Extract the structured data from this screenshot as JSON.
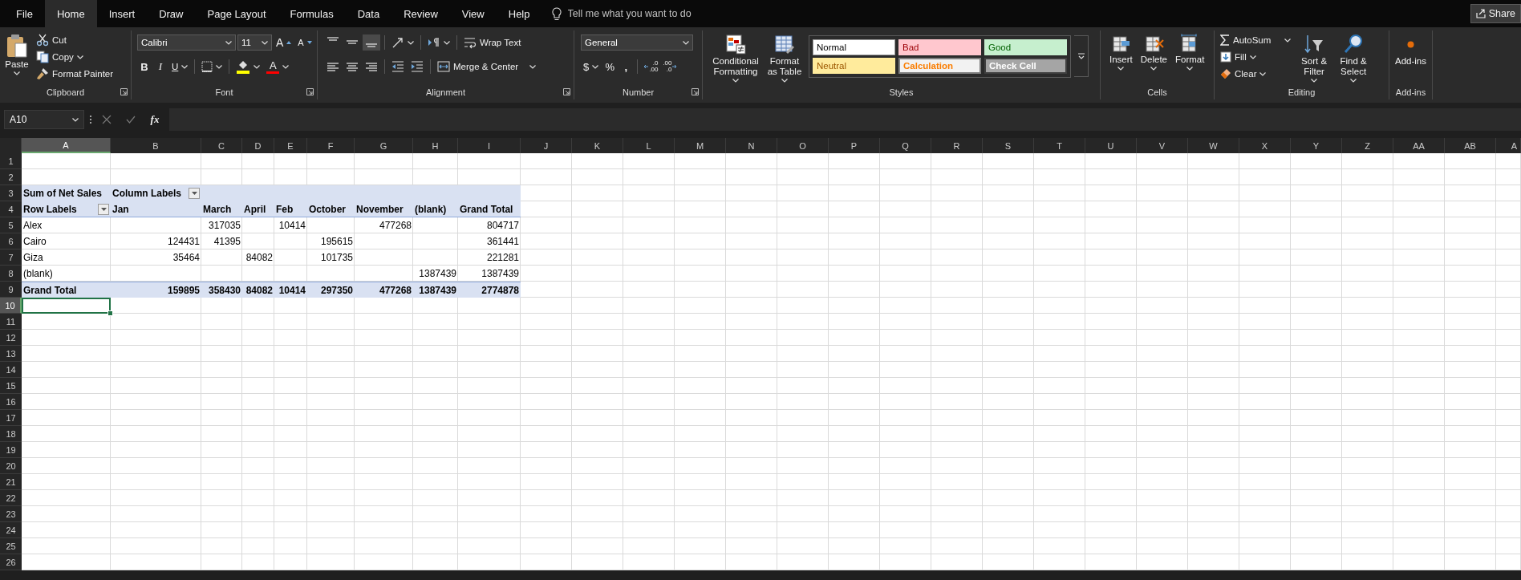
{
  "menu": {
    "tabs": [
      {
        "label": "File",
        "selected": false
      },
      {
        "label": "Home",
        "selected": true
      },
      {
        "label": "Insert",
        "selected": false
      },
      {
        "label": "Draw",
        "selected": false
      },
      {
        "label": "Page Layout",
        "selected": false
      },
      {
        "label": "Formulas",
        "selected": false
      },
      {
        "label": "Data",
        "selected": false
      },
      {
        "label": "Review",
        "selected": false
      },
      {
        "label": "View",
        "selected": false
      },
      {
        "label": "Help",
        "selected": false
      }
    ],
    "tell_me": {
      "placeholder": "Tell me what you want to do"
    },
    "share": "Share"
  },
  "ribbon": {
    "clipboard": {
      "label": "Clipboard",
      "paste": "Paste",
      "cut": "Cut",
      "copy": "Copy",
      "format_painter": "Format Painter"
    },
    "font": {
      "label": "Font",
      "font_name": "Calibri",
      "font_size": "11",
      "grow": "A",
      "shrink": "A",
      "bold": "B",
      "italic": "I",
      "underline": "U",
      "font_color": "A"
    },
    "alignment": {
      "label": "Alignment",
      "vertical": [
        {
          "kind": "top",
          "selected": false
        },
        {
          "kind": "middle",
          "selected": false
        },
        {
          "kind": "bottom",
          "selected": true
        }
      ],
      "wrap_text": "Wrap Text",
      "merge": "Merge & Center"
    },
    "number": {
      "label": "Number",
      "format": "General",
      "currency": "$",
      "percent": "%",
      "comma": ",",
      "increase_decimal": {
        "top": ".0",
        "bottom": ".00"
      },
      "decrease_decimal": {
        "top": ".00",
        "bottom": ".0"
      }
    },
    "styles": {
      "label": "Styles",
      "conditional": "Conditional Formatting",
      "format_table": "Format as Table",
      "cell_styles": [
        {
          "label": "Normal",
          "kind": "normal"
        },
        {
          "label": "Bad",
          "kind": "bad"
        },
        {
          "label": "Good",
          "kind": "good"
        },
        {
          "label": "Neutral",
          "kind": "neutral"
        },
        {
          "label": "Calculation",
          "kind": "calculation"
        },
        {
          "label": "Check Cell",
          "kind": "check"
        }
      ]
    },
    "cells": {
      "label": "Cells",
      "buttons": [
        {
          "label": "Insert",
          "kind": "insert"
        },
        {
          "label": "Delete",
          "kind": "delete"
        },
        {
          "label": "Format",
          "kind": "format"
        }
      ]
    },
    "editing": {
      "label": "Editing",
      "autosum": "AutoSum",
      "fill": "Fill",
      "clear": "Clear",
      "sort": "Sort & Filter",
      "find": "Find & Select"
    },
    "addins": {
      "label": "Add-ins",
      "button": "Add-ins"
    }
  },
  "formula_bar": {
    "name_box": "A10",
    "fx": "fx"
  },
  "sheet": {
    "columns": [
      {
        "label": "A",
        "selected": true
      },
      {
        "label": "B",
        "selected": false
      },
      {
        "label": "C",
        "selected": false
      },
      {
        "label": "D",
        "selected": false
      },
      {
        "label": "E",
        "selected": false
      },
      {
        "label": "F",
        "selected": false
      },
      {
        "label": "G",
        "selected": false
      },
      {
        "label": "H",
        "selected": false
      },
      {
        "label": "I",
        "selected": false
      },
      {
        "label": "J",
        "selected": false
      },
      {
        "label": "K",
        "selected": false
      },
      {
        "label": "L",
        "selected": false
      },
      {
        "label": "M",
        "selected": false
      },
      {
        "label": "N",
        "selected": false
      },
      {
        "label": "O",
        "selected": false
      },
      {
        "label": "P",
        "selected": false
      },
      {
        "label": "Q",
        "selected": false
      },
      {
        "label": "R",
        "selected": false
      },
      {
        "label": "S",
        "selected": false
      },
      {
        "label": "T",
        "selected": false
      },
      {
        "label": "U",
        "selected": false
      },
      {
        "label": "V",
        "selected": false
      },
      {
        "label": "W",
        "selected": false
      },
      {
        "label": "X",
        "selected": false
      },
      {
        "label": "Y",
        "selected": false
      },
      {
        "label": "Z",
        "selected": false
      },
      {
        "label": "AA",
        "selected": false
      },
      {
        "label": "AB",
        "selected": false
      },
      {
        "label": "A",
        "selected": false
      }
    ],
    "rows": [
      {
        "label": "1",
        "kind": "plain",
        "selected": false
      },
      {
        "label": "2",
        "kind": "plain",
        "selected": false
      },
      {
        "label": "3",
        "kind": "pivot_title",
        "selected": false,
        "cells": [
          {
            "text": "Sum of Net Sales",
            "kind": "value"
          },
          {
            "text": "Column Labels",
            "kind": "field"
          },
          {
            "text": "",
            "kind": "value"
          },
          {
            "text": "",
            "kind": "value"
          },
          {
            "text": "",
            "kind": "value"
          },
          {
            "text": "",
            "kind": "value"
          },
          {
            "text": "",
            "kind": "value"
          },
          {
            "text": "",
            "kind": "value"
          },
          {
            "text": "",
            "kind": "value"
          }
        ]
      },
      {
        "label": "4",
        "kind": "pivot_header",
        "selected": false,
        "cells": [
          {
            "text": "Row Labels",
            "kind": "field"
          },
          {
            "text": "Jan",
            "kind": "value"
          },
          {
            "text": "March",
            "kind": "value"
          },
          {
            "text": "April",
            "kind": "value"
          },
          {
            "text": "Feb",
            "kind": "value"
          },
          {
            "text": "October",
            "kind": "value"
          },
          {
            "text": "November",
            "kind": "value"
          },
          {
            "text": "(blank)",
            "kind": "value"
          },
          {
            "text": "Grand Total",
            "kind": "value"
          }
        ]
      },
      {
        "label": "5",
        "kind": "pivot_body",
        "selected": false,
        "cells": [
          "Alex",
          "",
          "317035",
          "",
          "10414",
          "",
          "477268",
          "",
          "804717"
        ]
      },
      {
        "label": "6",
        "kind": "pivot_body",
        "selected": false,
        "cells": [
          "Cairo",
          "124431",
          "41395",
          "",
          "",
          "195615",
          "",
          "",
          "361441"
        ]
      },
      {
        "label": "7",
        "kind": "pivot_body",
        "selected": false,
        "cells": [
          "Giza",
          "35464",
          "",
          "84082",
          "",
          "101735",
          "",
          "",
          "221281"
        ]
      },
      {
        "label": "8",
        "kind": "pivot_body",
        "selected": false,
        "cells": [
          "(blank)",
          "",
          "",
          "",
          "",
          "",
          "",
          "1387439",
          "1387439"
        ]
      },
      {
        "label": "9",
        "kind": "pivot_total",
        "selected": false,
        "cells": [
          "Grand Total",
          "159895",
          "358430",
          "84082",
          "10414",
          "297350",
          "477268",
          "1387439",
          "2774878"
        ]
      },
      {
        "label": "10",
        "kind": "plain",
        "selected": true
      },
      {
        "label": "11",
        "kind": "plain",
        "selected": false
      },
      {
        "label": "12",
        "kind": "plain",
        "selected": false
      },
      {
        "label": "13",
        "kind": "plain",
        "selected": false
      },
      {
        "label": "14",
        "kind": "plain",
        "selected": false
      },
      {
        "label": "15",
        "kind": "plain",
        "selected": false
      },
      {
        "label": "16",
        "kind": "plain",
        "selected": false
      },
      {
        "label": "17",
        "kind": "plain",
        "selected": false
      },
      {
        "label": "18",
        "kind": "plain",
        "selected": false
      },
      {
        "label": "19",
        "kind": "plain",
        "selected": false
      },
      {
        "label": "20",
        "kind": "plain",
        "selected": false
      },
      {
        "label": "21",
        "kind": "plain",
        "selected": false
      },
      {
        "label": "22",
        "kind": "plain",
        "selected": false
      },
      {
        "label": "23",
        "kind": "plain",
        "selected": false
      },
      {
        "label": "24",
        "kind": "plain",
        "selected": false
      },
      {
        "label": "25",
        "kind": "plain",
        "selected": false
      },
      {
        "label": "26",
        "kind": "plain",
        "selected": false
      }
    ]
  }
}
